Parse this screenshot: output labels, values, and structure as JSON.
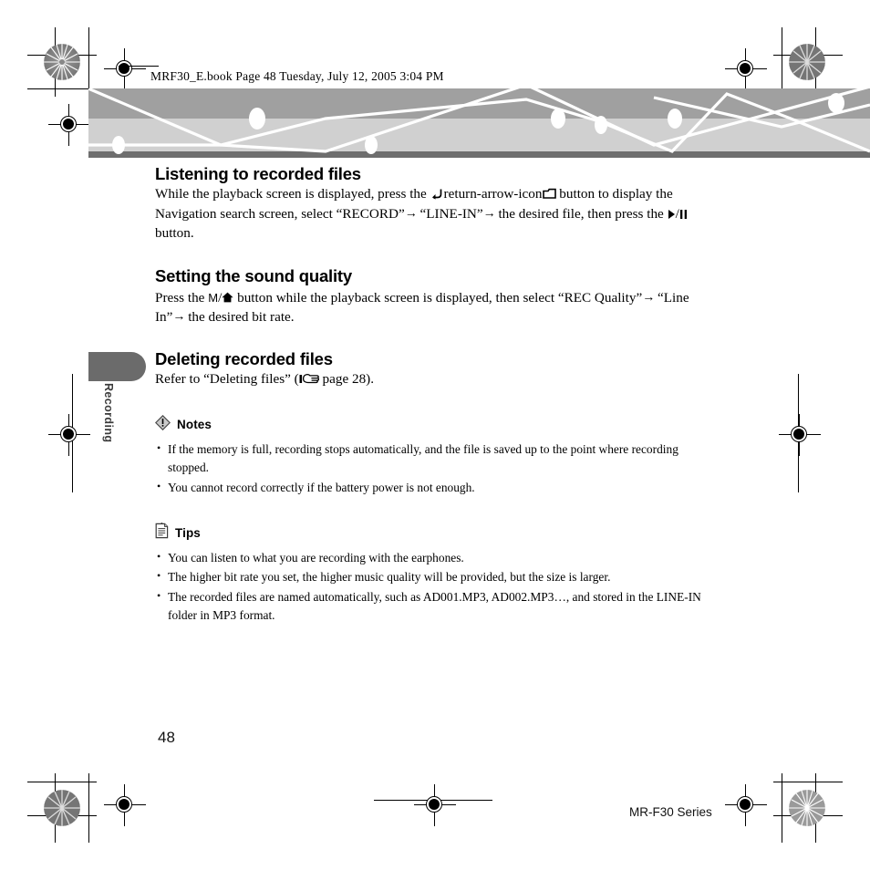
{
  "document": {
    "header_line": "MRF30_E.book  Page 48  Tuesday, July 12, 2005  3:04 PM",
    "page_number": "48",
    "series_footer": "MR-F30 Series",
    "side_tab_label": "Recording"
  },
  "sections": [
    {
      "heading": "Listening to recorded files",
      "body_parts": [
        {
          "type": "text",
          "value": "While the playback screen is displayed, press the "
        },
        {
          "type": "icon",
          "value": "return-arrow-icon"
        },
        {
          "type": "text",
          "value": "/"
        },
        {
          "type": "icon",
          "value": "folder-icon"
        },
        {
          "type": "text",
          "value": " button to display the Navigation search screen, select “RECORD”"
        },
        {
          "type": "icon",
          "value": "right-arrow-icon"
        },
        {
          "type": "text",
          "value": " “LINE-IN”"
        },
        {
          "type": "icon",
          "value": "right-arrow-icon"
        },
        {
          "type": "text",
          "value": " the desired file, then press the "
        },
        {
          "type": "icon",
          "value": "play-icon"
        },
        {
          "type": "text",
          "value": "/"
        },
        {
          "type": "icon",
          "value": "pause-icon"
        },
        {
          "type": "text",
          "value": " button."
        }
      ]
    },
    {
      "heading": "Setting the sound quality",
      "body_parts": [
        {
          "type": "text",
          "value": "Press the "
        },
        {
          "type": "icon",
          "value": "m-letter-icon"
        },
        {
          "type": "text",
          "value": "/"
        },
        {
          "type": "icon",
          "value": "home-icon"
        },
        {
          "type": "text",
          "value": " button while the playback screen is displayed, then select “REC Quality”"
        },
        {
          "type": "icon",
          "value": "right-arrow-icon"
        },
        {
          "type": "text",
          "value": " “Line In”"
        },
        {
          "type": "icon",
          "value": "right-arrow-icon"
        },
        {
          "type": "text",
          "value": " the desired bit rate."
        }
      ]
    },
    {
      "heading": "Deleting recorded files",
      "body_parts": [
        {
          "type": "text",
          "value": "Refer to “Deleting files” ("
        },
        {
          "type": "icon",
          "value": "pointing-hand-icon"
        },
        {
          "type": "text",
          "value": " page 28)."
        }
      ]
    }
  ],
  "notes": {
    "icon": "warning-diamond-icon",
    "label": "Notes",
    "items": [
      "If the memory is full, recording stops automatically, and the file is saved up to the point where recording stopped.",
      "You cannot record correctly if the battery power is not enough."
    ]
  },
  "tips": {
    "icon": "note-page-icon",
    "label": "Tips",
    "items": [
      "You can listen to what you are recording with the earphones.",
      "The higher bit rate you set, the higher music quality will be provided, but the size is larger.",
      "The recorded files are named automatically, such as AD001.MP3, AD002.MP3…, and stored in the LINE-IN folder in MP3 format."
    ]
  },
  "colors": {
    "banner_dark": "#a0a0a0",
    "banner_light": "#d0d0d0",
    "banner_bottom": "#6e6e6e",
    "side_tab": "#6b6b6b",
    "text": "#000000"
  }
}
